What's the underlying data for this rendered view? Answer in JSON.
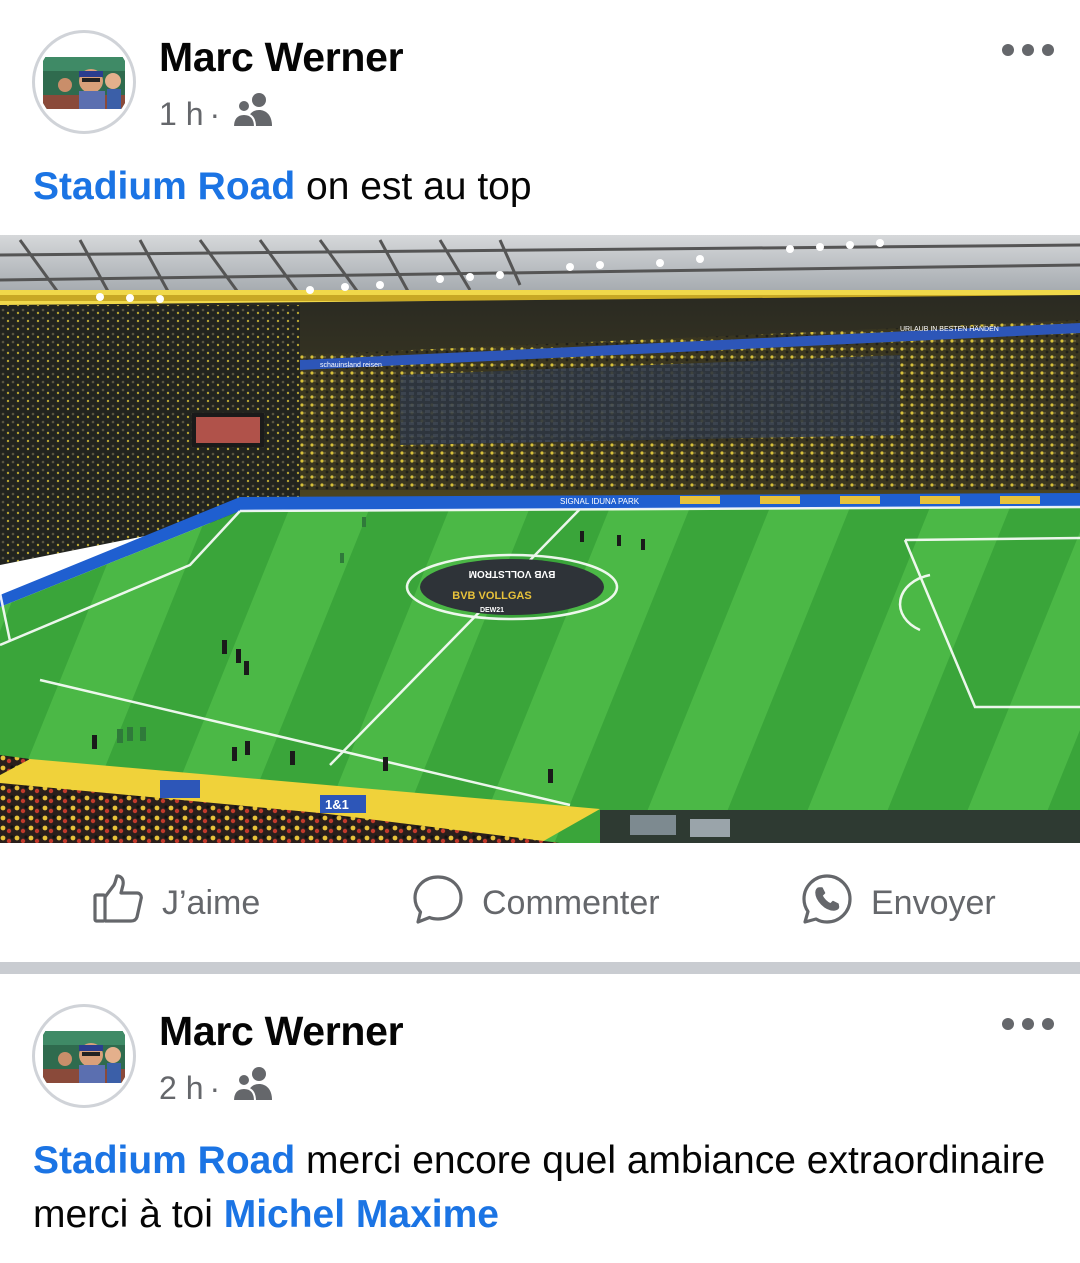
{
  "posts": [
    {
      "author": "Marc Werner",
      "time": "1 h",
      "separator": "·",
      "audience_icon": "group-icon",
      "tagged_group": "Stadium Road",
      "text_after_tag": " on est au top",
      "photo_icon": "stadium-photo",
      "stadium_signage": {
        "banner": "schauinsland reisen",
        "banner_secondary": "URLAUB IN BESTEN HÄNDEN",
        "stadium_name": "SIGNAL IDUNA PARK",
        "pitch_logo_top": "BVB VOLLSTROM",
        "pitch_logo_main": "BVB VOLLGAS",
        "pitch_logo_bottom": "DEW21",
        "sponsor": "1&1"
      },
      "actions": {
        "like_label": "J’aime",
        "comment_label": "Commenter",
        "send_label": "Envoyer"
      }
    },
    {
      "author": "Marc Werner",
      "time": "2 h",
      "separator": "·",
      "audience_icon": "group-icon",
      "tagged_group": "Stadium Road",
      "text_middle": " merci encore quel ambiance extraordinaire merci à toi ",
      "tagged_person": "Michel Maxime"
    }
  ],
  "colors": {
    "link_blue": "#1b74e4",
    "secondary_text": "#65676b",
    "divider": "#c9ccd1"
  }
}
